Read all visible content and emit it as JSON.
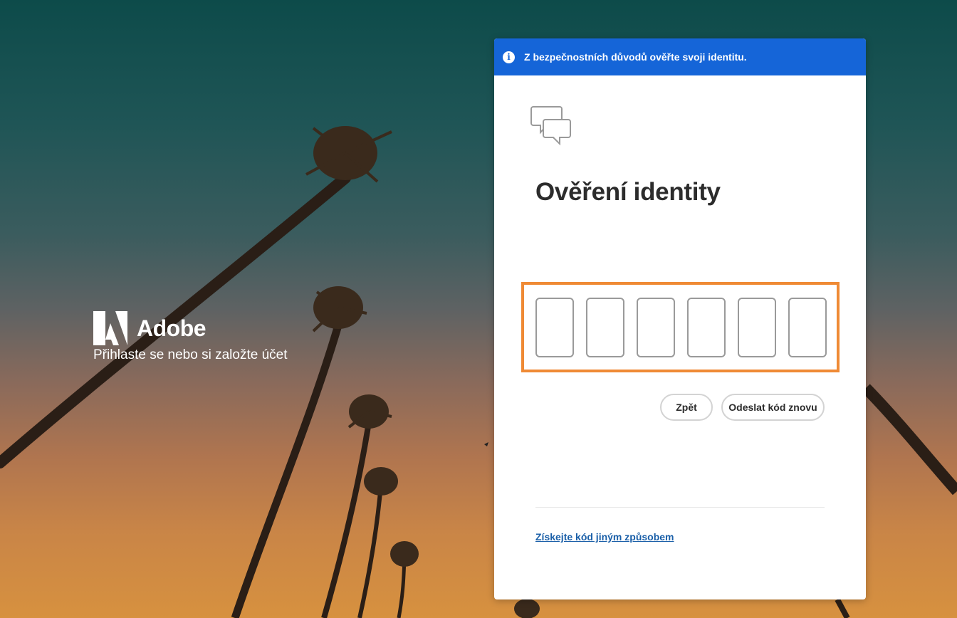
{
  "brand": {
    "name": "Adobe",
    "tagline": "Přihlaste se nebo si založte účet",
    "logo_icon": "adobe-logo-icon"
  },
  "card": {
    "banner_text": "Z bezpečnostních důvodů ověřte svoji identitu.",
    "banner_icon": "info-icon",
    "title": "Ověření identity",
    "illustration_icon": "chat-bubbles-icon",
    "code_digits": [
      "",
      "",
      "",
      "",
      "",
      ""
    ],
    "back_label": "Zpět",
    "resend_label": "Odeslat kód znovu",
    "alt_link": "Získejte kód jiným způsobem"
  },
  "colors": {
    "banner": "#1565d8",
    "highlight": "#ef8a35",
    "link": "#1a5fa8"
  }
}
